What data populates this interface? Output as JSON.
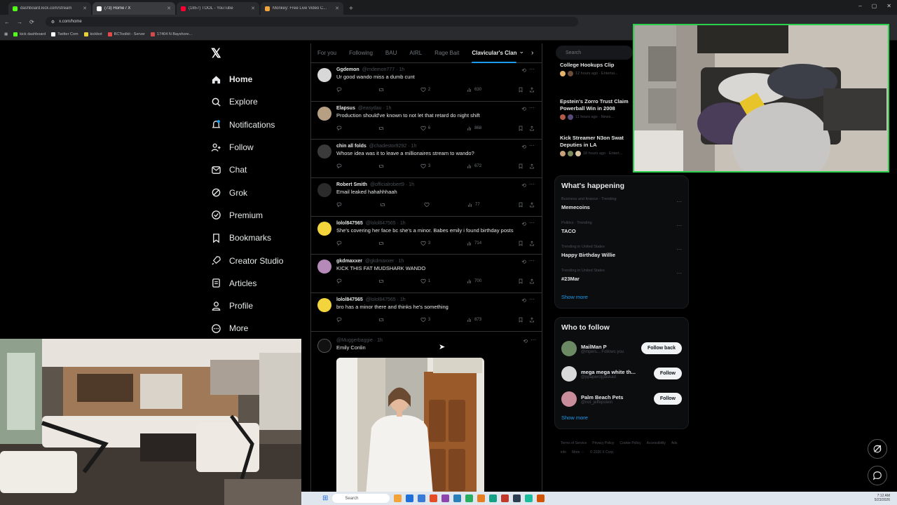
{
  "browser": {
    "tabs": [
      {
        "label": "dashboard.kick.com/stream",
        "color": "#53fc18",
        "active": false
      },
      {
        "label": "(73) Home / X",
        "color": "#ffffff",
        "active": true
      },
      {
        "label": "(1857) TOOL - YouTube",
        "color": "#ff0033",
        "active": false
      },
      {
        "label": "Monkey: Free Live Video C...",
        "color": "#f2a33a",
        "active": false
      }
    ],
    "new_tab": "+",
    "url": "x.com/home",
    "bookmarks": [
      {
        "label": "kick dashboard",
        "color": "#53fc18"
      },
      {
        "label": "Twitter Com",
        "color": "#ffffff"
      },
      {
        "label": "kickbot",
        "color": "#e6d23a"
      },
      {
        "label": "BCToolkit - Server",
        "color": "#e34b4b"
      },
      {
        "label": "17404 N Bayshore...",
        "color": "#d24a4a"
      }
    ]
  },
  "nav": {
    "logo": "𝕏",
    "items": [
      {
        "label": "Home",
        "icon": "home-icon"
      },
      {
        "label": "Explore",
        "icon": "search-icon"
      },
      {
        "label": "Notifications",
        "icon": "bell-icon"
      },
      {
        "label": "Follow",
        "icon": "follow-icon"
      },
      {
        "label": "Chat",
        "icon": "chat-icon"
      },
      {
        "label": "Grok",
        "icon": "grok-icon"
      },
      {
        "label": "Premium",
        "icon": "premium-icon"
      },
      {
        "label": "Bookmarks",
        "icon": "bookmark-icon"
      },
      {
        "label": "Creator Studio",
        "icon": "rocket-icon"
      },
      {
        "label": "Articles",
        "icon": "article-icon"
      },
      {
        "label": "Profile",
        "icon": "profile-icon"
      },
      {
        "label": "More",
        "icon": "more-icon"
      }
    ]
  },
  "feed": {
    "tabs": [
      "For you",
      "Following",
      "BAU",
      "AIRL",
      "Rage Bait",
      "Clavicular's Clan"
    ],
    "active_tab": "Clavicular's Clan",
    "posts": [
      {
        "name": "Ggdemon",
        "handle": "@rndemon777 · 1h",
        "text": "Ur good wando miss a dumb cunt",
        "avatar": "#d8d8d8",
        "replies": "",
        "retweets": "",
        "likes": "2",
        "views": "630"
      },
      {
        "name": "Elapsus",
        "handle": "@easydau · 1h",
        "text": "Production should've known to not let that retard do night shift",
        "avatar": "#b79f83",
        "replies": "",
        "retweets": "",
        "likes": "6",
        "views": "868"
      },
      {
        "name": "chin all folds",
        "handle": "@chadestor9292 · 1h",
        "text": "Whose idea was it to leave a millionaires stream to wando?",
        "avatar": "#3a3a3a",
        "replies": "",
        "retweets": "",
        "likes": "3",
        "views": "672"
      },
      {
        "name": "Robert Smith",
        "handle": "@officialrobert9 · 1h",
        "text": "Email leaked hahahhhaah",
        "avatar": "#2b2b2b",
        "replies": "",
        "retweets": "",
        "likes": "",
        "views": "77"
      },
      {
        "name": "lolol847565",
        "handle": "@lolol847565 · 1h",
        "text": "She's covering her face bc she's a minor. Babes emily i found birthday posts",
        "avatar": "#f4d43d",
        "replies": "",
        "retweets": "",
        "likes": "3",
        "views": "714"
      },
      {
        "name": "gkdmaxxer",
        "handle": "@gkdmaxxer · 1h",
        "text": "KICK THIS FAT MUDSHARK WANDO",
        "avatar": "#b58ab8",
        "replies": "",
        "retweets": "",
        "likes": "1",
        "views": "700"
      },
      {
        "name": "lolol847565",
        "handle": "@lolol847565 · 1h",
        "text": "bro has a minor there and thinks he's something",
        "avatar": "#f4d43d",
        "replies": "",
        "retweets": "",
        "likes": "3",
        "views": "873"
      }
    ],
    "last_post": {
      "name": "",
      "handle": "@Muggerbaggie · 1h",
      "text": "Emily Conlin",
      "avatar": "#333333"
    }
  },
  "sidebar": {
    "search_placeholder": "Search",
    "top_trends": [
      {
        "title": "College Hookups Clip",
        "meta": "12 hours ago · Entertai..."
      },
      {
        "title": "Epstein's Zorro Trust Claim Powerball Win in 2008",
        "meta": "11 hours ago · News..."
      },
      {
        "title": "Kick Streamer N3on Swat Deputies in LA",
        "meta": "18 hours ago · Entert..."
      }
    ],
    "happening": {
      "title": "What's happening",
      "items": [
        {
          "meta": "Business and finance · Trending",
          "title": "Memecoins"
        },
        {
          "meta": "Politics · Trending",
          "title": "TACO"
        },
        {
          "meta": "Trending in United States",
          "title": "Happy Birthday Willie"
        },
        {
          "meta": "Trending in United States",
          "title": "#23Mar"
        }
      ],
      "show_more": "Show more"
    },
    "who_to_follow": {
      "title": "Who to follow",
      "items": [
        {
          "name": "MailMan P",
          "handle": "@mpers... Follows you",
          "button": "Follow back",
          "color": "#6b8a63"
        },
        {
          "name": "mega mega white th...",
          "handle": "@ppapercljpaskad",
          "button": "Follow",
          "color": "#d9d9d9"
        },
        {
          "name": "Palm Beach Pets",
          "handle": "@not_jeffepstein",
          "button": "Follow",
          "color": "#c98c9b"
        }
      ],
      "show_more": "Show more"
    },
    "footer": [
      "Terms of Service",
      "Privacy Policy",
      "Cookie Policy",
      "Accessibility",
      "Ads info",
      "More ···",
      "© 2026 X Corp."
    ]
  },
  "taskbar": {
    "search": "Search",
    "time": "7:12 AM",
    "date": "5/23/2026"
  },
  "accent": "#1d9bf0",
  "cam_border": "#2bd14a"
}
